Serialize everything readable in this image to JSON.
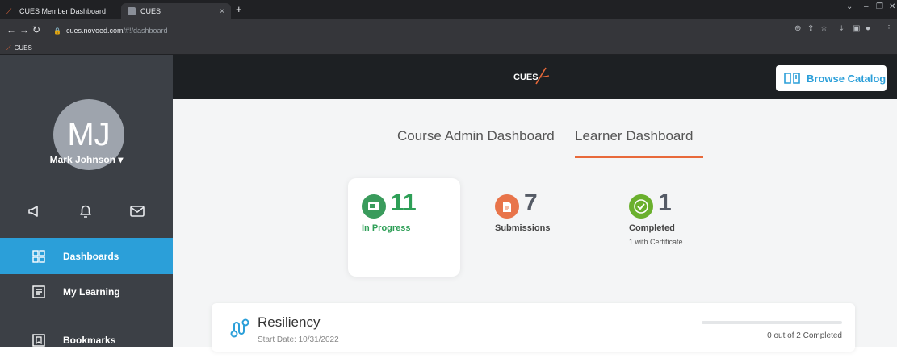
{
  "browser": {
    "tabs": [
      {
        "title": "CUES Member Dashboard",
        "close": "×"
      },
      {
        "title": "CUES",
        "close": "×"
      }
    ],
    "new_tab": "+",
    "url_host": "cues.novoed.com",
    "url_path": "/#!/dashboard",
    "bookmark": "CUES"
  },
  "sidebar": {
    "avatar_initials": "MJ",
    "user_name": "Mark Johnson ▾",
    "items": [
      {
        "label": "Dashboards",
        "icon": "grid-icon"
      },
      {
        "label": "My Learning",
        "icon": "list-icon"
      },
      {
        "label": "Bookmarks",
        "icon": "bookmark-icon"
      }
    ]
  },
  "header": {
    "logo_text": "CUES",
    "browse_label": "Browse Catalog"
  },
  "main": {
    "tabs": [
      {
        "label": "Course Admin Dashboard"
      },
      {
        "label": "Learner Dashboard"
      }
    ],
    "stats": [
      {
        "value": "11",
        "label": "In Progress",
        "sub": "",
        "color": "#2e9f57"
      },
      {
        "value": "7",
        "label": "Submissions",
        "sub": "",
        "color": "#555b66"
      },
      {
        "value": "1",
        "label": "Completed",
        "sub": "1 with Certificate",
        "color": "#555b66"
      }
    ],
    "course": {
      "title": "Resiliency",
      "start_date": "Start Date: 10/31/2022",
      "status": "0 out of 2 Completed",
      "progress": 0
    }
  },
  "colors": {
    "accent": "#2b9fd9",
    "tab_underline": "#e8693a",
    "in_progress": "#2e9f57",
    "submissions": "#e8744a",
    "completed": "#6ab02d"
  }
}
